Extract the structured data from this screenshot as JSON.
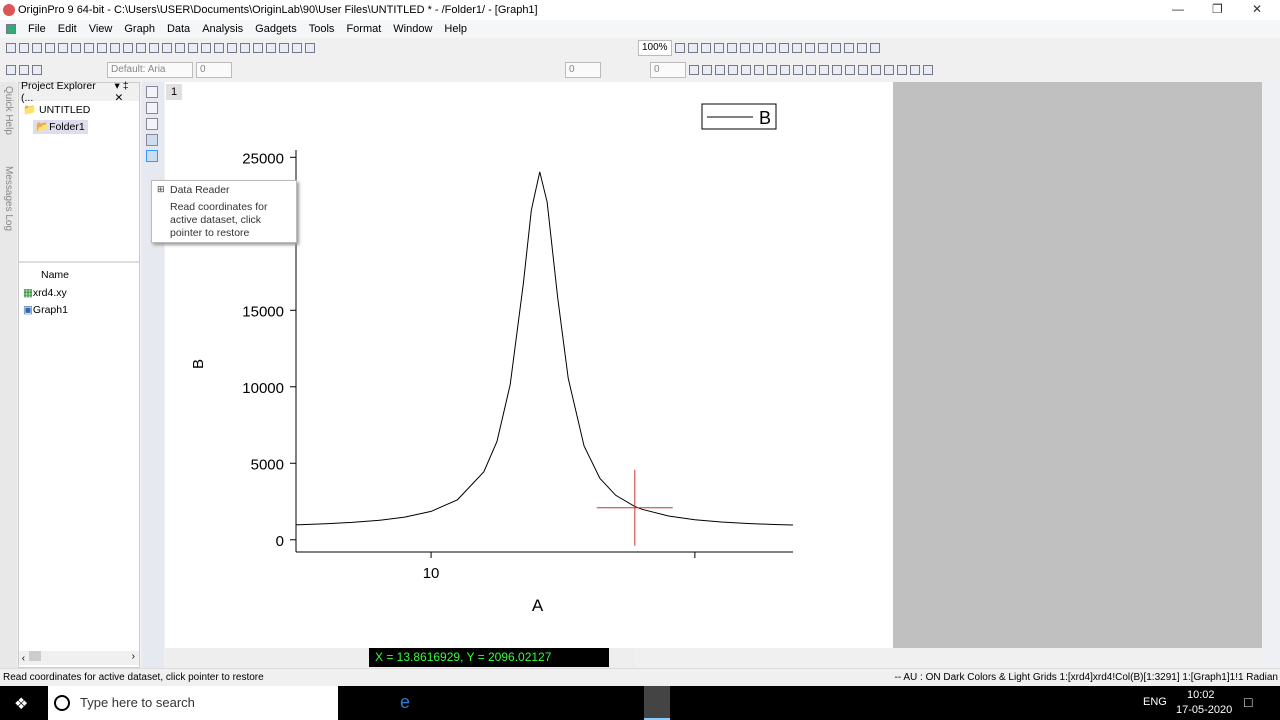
{
  "window": {
    "title": "OriginPro 9 64-bit - C:\\Users\\USER\\Documents\\OriginLab\\90\\User Files\\UNTITLED * - /Folder1/ - [Graph1]"
  },
  "menu": [
    "File",
    "Edit",
    "View",
    "Graph",
    "Data",
    "Analysis",
    "Gadgets",
    "Tools",
    "Format",
    "Window",
    "Help"
  ],
  "toolbar": {
    "zoom": "100%",
    "font": "Default: Aria",
    "font_size": "0",
    "line_width": "0",
    "size2": "0"
  },
  "side_tabs": {
    "quick_help": "Quick Help",
    "messages_log": "Messages Log"
  },
  "project_explorer": {
    "title": "Project Explorer (...",
    "root": "UNTITLED",
    "folder": "Folder1",
    "column_header": "Name",
    "items": [
      "xrd4.xy",
      "Graph1"
    ]
  },
  "page_number": "1",
  "tooltip": {
    "title": "Data Reader",
    "body": "Read coordinates for active dataset, click pointer to restore"
  },
  "readout": "X = 13.8616929, Y = 2096.02127",
  "status": {
    "left": "Read coordinates for active dataset, click pointer to restore",
    "right": "-- AU : ON  Dark Colors & Light Grids  1:[xrd4]xrd4!Col(B)[1:3291]  1:[Graph1]1!1  Radian"
  },
  "taskbar": {
    "search": "Type here to search",
    "lang": "ENG",
    "time": "10:02",
    "date": "17-05-2020"
  },
  "chart_data": {
    "type": "line",
    "xlabel": "A",
    "ylabel": "B",
    "xlim": [
      7.44,
      16.86
    ],
    "ylim": [
      -800,
      26000
    ],
    "xticks": [
      10,
      15
    ],
    "xtick_labels": [
      "10",
      ""
    ],
    "yticks": [
      0,
      5000,
      10000,
      15000,
      20000,
      25000
    ],
    "ytick_labels": [
      "0",
      "5000",
      "10000",
      "15000",
      "",
      "25000"
    ],
    "legend": {
      "entries": [
        "B"
      ],
      "position": "top-right"
    },
    "grid": false,
    "cursor": {
      "x": 13.8616929,
      "y": 2096.02127
    },
    "series": [
      {
        "name": "B",
        "color": "#000000",
        "x": [
          7.44,
          7.5,
          8,
          8.5,
          9,
          9.5,
          10,
          10.5,
          11,
          11.25,
          11.5,
          11.75,
          11.9,
          12.06,
          12.2,
          12.4,
          12.6,
          12.9,
          13.2,
          13.5,
          13.86,
          14,
          14.5,
          15,
          15.5,
          16,
          16.5,
          16.86
        ],
        "y": [
          980,
          985,
          1045,
          1133,
          1264,
          1478,
          1854,
          2614,
          4443,
          6433,
          10145,
          16775,
          21535,
          24050,
          22075,
          15821,
          10548,
          6131,
          4013,
          2907,
          2179,
          1989,
          1551,
          1307,
          1159,
          1063,
          997,
          965
        ]
      }
    ]
  }
}
